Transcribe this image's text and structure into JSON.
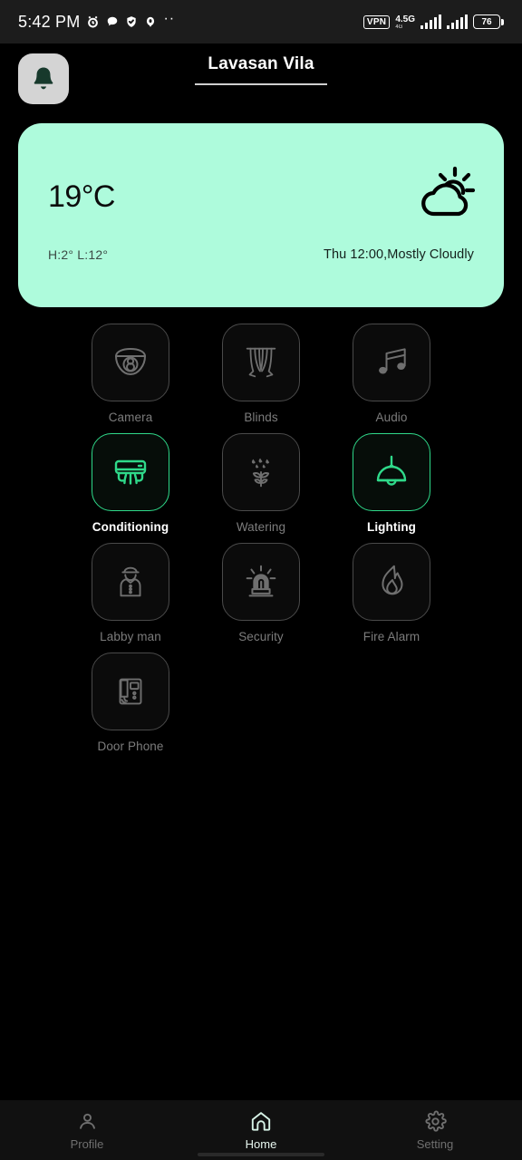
{
  "status_bar": {
    "time": "5:42 PM",
    "left_icons": [
      "alarm-clock-icon",
      "chat-bubble-icon",
      "shield-check-icon",
      "app-icon"
    ],
    "overflow": "··",
    "vpn_label": "VPN",
    "network_type": "4.5G",
    "network_sub": "4G",
    "battery_level": "76"
  },
  "header": {
    "notification_icon": "bell-icon",
    "title": "Lavasan Vila"
  },
  "weather": {
    "temperature": "19°C",
    "high_low": "H:2° L:12°",
    "condition": "Thu 12:00,Mostly Cloudly",
    "icon": "sun-behind-cloud-icon",
    "card_color": "#aefbdc"
  },
  "devices": [
    {
      "label": "Camera",
      "icon": "dome-camera-icon",
      "active": false
    },
    {
      "label": "Blinds",
      "icon": "curtains-icon",
      "active": false
    },
    {
      "label": "Audio",
      "icon": "music-note-icon",
      "active": false
    },
    {
      "label": "Conditioning",
      "icon": "air-conditioner-icon",
      "active": true
    },
    {
      "label": "Watering",
      "icon": "plant-watering-icon",
      "active": false
    },
    {
      "label": "Lighting",
      "icon": "pendant-lamp-icon",
      "active": true
    },
    {
      "label": "Labby man",
      "icon": "doorman-icon",
      "active": false
    },
    {
      "label": "Security",
      "icon": "siren-icon",
      "active": false
    },
    {
      "label": "Fire Alarm",
      "icon": "flame-icon",
      "active": false
    },
    {
      "label": "Door Phone",
      "icon": "intercom-icon",
      "active": false
    }
  ],
  "bottom_nav": [
    {
      "label": "Profile",
      "icon": "person-icon",
      "active": false
    },
    {
      "label": "Home",
      "icon": "house-icon",
      "active": true
    },
    {
      "label": "Setting",
      "icon": "gear-icon",
      "active": false
    }
  ],
  "colors": {
    "accent_green": "#2fd98a",
    "inactive_gray": "#7c7c7c",
    "background": "#000000"
  }
}
